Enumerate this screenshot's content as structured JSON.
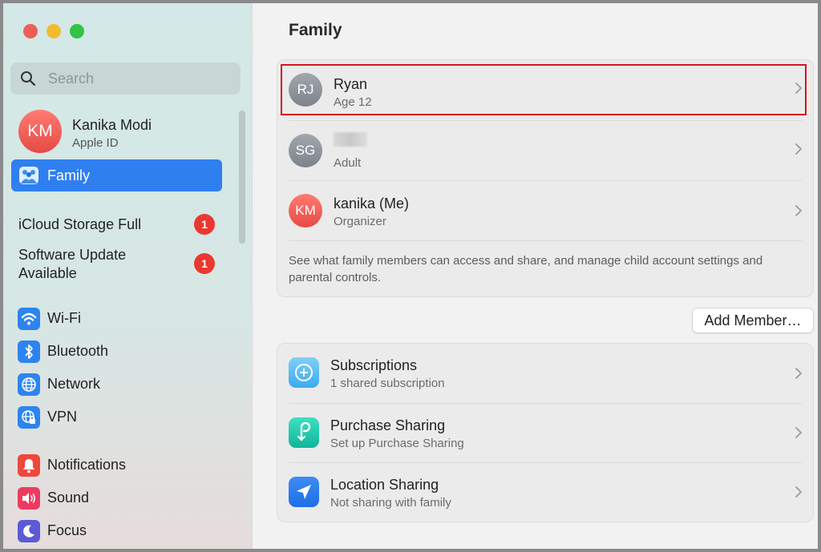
{
  "window": {
    "controls": [
      "close",
      "minimize",
      "zoom"
    ]
  },
  "sidebar": {
    "search_placeholder": "Search",
    "account": {
      "initials": "KM",
      "name": "Kanika Modi",
      "subtitle": "Apple ID"
    },
    "selected_item": {
      "label": "Family",
      "icon": "family-icon"
    },
    "alerts": [
      {
        "label": "iCloud Storage Full",
        "badge": "1"
      },
      {
        "label_line1": "Software Update",
        "label_line2": "Available",
        "badge": "1"
      }
    ],
    "network_items": [
      {
        "label": "Wi-Fi",
        "icon": "wifi-icon"
      },
      {
        "label": "Bluetooth",
        "icon": "bluetooth-icon"
      },
      {
        "label": "Network",
        "icon": "globe-icon"
      },
      {
        "label": "VPN",
        "icon": "vpn-icon"
      }
    ],
    "system_items": [
      {
        "label": "Notifications",
        "icon": "bell-icon"
      },
      {
        "label": "Sound",
        "icon": "speaker-icon"
      },
      {
        "label": "Focus",
        "icon": "moon-icon"
      }
    ]
  },
  "main": {
    "title": "Family",
    "members": [
      {
        "initials": "RJ",
        "name": "Ryan",
        "subtitle": "Age 12",
        "highlighted": true
      },
      {
        "initials": "SG",
        "name": "",
        "subtitle": "Adult",
        "name_redacted": true
      },
      {
        "initials": "KM",
        "name": "kanika (Me)",
        "subtitle": "Organizer"
      }
    ],
    "description": "See what family members can access and share, and manage child account settings and parental controls.",
    "add_member_label": "Add Member…",
    "features": [
      {
        "name": "Subscriptions",
        "subtitle": "1 shared subscription",
        "icon": "subscriptions-icon"
      },
      {
        "name": "Purchase Sharing",
        "subtitle": "Set up Purchase Sharing",
        "icon": "purchase-sharing-icon"
      },
      {
        "name": "Location Sharing",
        "subtitle": "Not sharing with family",
        "icon": "location-arrow-icon"
      }
    ]
  },
  "colors": {
    "accent": "#2f7ff1",
    "badge": "#eb3830",
    "highlight_border": "#d4141b"
  }
}
